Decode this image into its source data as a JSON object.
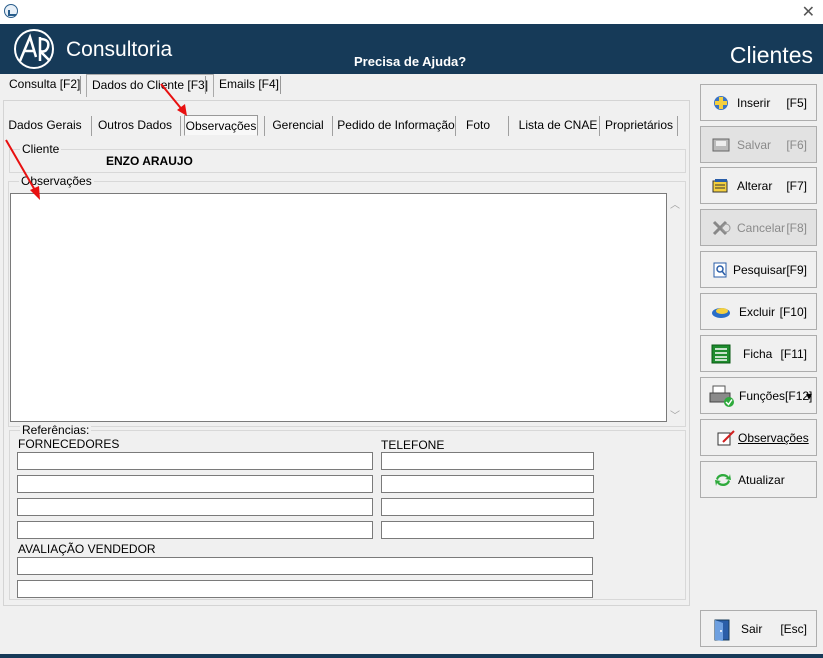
{
  "window": {
    "close_glyph": "✕"
  },
  "header": {
    "logo_text": "Consultoria",
    "help_text": "Precisa de Ajuda?",
    "module_title": "Clientes"
  },
  "top_tabs": [
    {
      "label": "Consulta [F2]"
    },
    {
      "label": "Dados do Cliente [F3]"
    },
    {
      "label": "Emails [F4]"
    }
  ],
  "sub_tabs": [
    {
      "label": "Dados Gerais"
    },
    {
      "label": "Outros Dados"
    },
    {
      "label": "Observações"
    },
    {
      "label": "Gerencial"
    },
    {
      "label": "Pedido de Informação"
    },
    {
      "label": "Foto"
    },
    {
      "label": "Lista de CNAE"
    },
    {
      "label": "Proprietários"
    }
  ],
  "client_group": {
    "label": "Cliente",
    "name": "ENZO ARAUJO"
  },
  "observations_group": {
    "label": "Observações",
    "value": ""
  },
  "references": {
    "label": "Referências:",
    "suppliers_label": "FORNECEDORES",
    "phone_label": "TELEFONE",
    "seller_rating_label": "AVALIAÇÃO VENDEDOR"
  },
  "buttons": [
    {
      "label": "Inserir",
      "key": "[F5]",
      "icon": "plus-icon"
    },
    {
      "label": "Salvar",
      "key": "[F6]",
      "icon": "save-icon"
    },
    {
      "label": "Alterar",
      "key": "[F7]",
      "icon": "edit-icon"
    },
    {
      "label": "Cancelar",
      "key": "[F8]",
      "icon": "cancel-icon"
    },
    {
      "label": "Pesquisar",
      "key": "[F9]",
      "icon": "search-icon"
    },
    {
      "label": "Excluir",
      "key": "[F10]",
      "icon": "delete-icon"
    },
    {
      "label": "Ficha",
      "key": "[F11]",
      "icon": "sheet-icon"
    },
    {
      "label": "Funções[F12]",
      "key": "▾",
      "icon": "printer-icon"
    },
    {
      "label": "Observações",
      "key": "",
      "icon": "notes-icon"
    },
    {
      "label": "Atualizar",
      "key": "",
      "icon": "refresh-icon"
    },
    {
      "label": "Sair",
      "key": "[Esc]",
      "icon": "exit-door-icon"
    }
  ],
  "colors": {
    "header_bg": "#163a58",
    "arrow": "#e81010"
  }
}
